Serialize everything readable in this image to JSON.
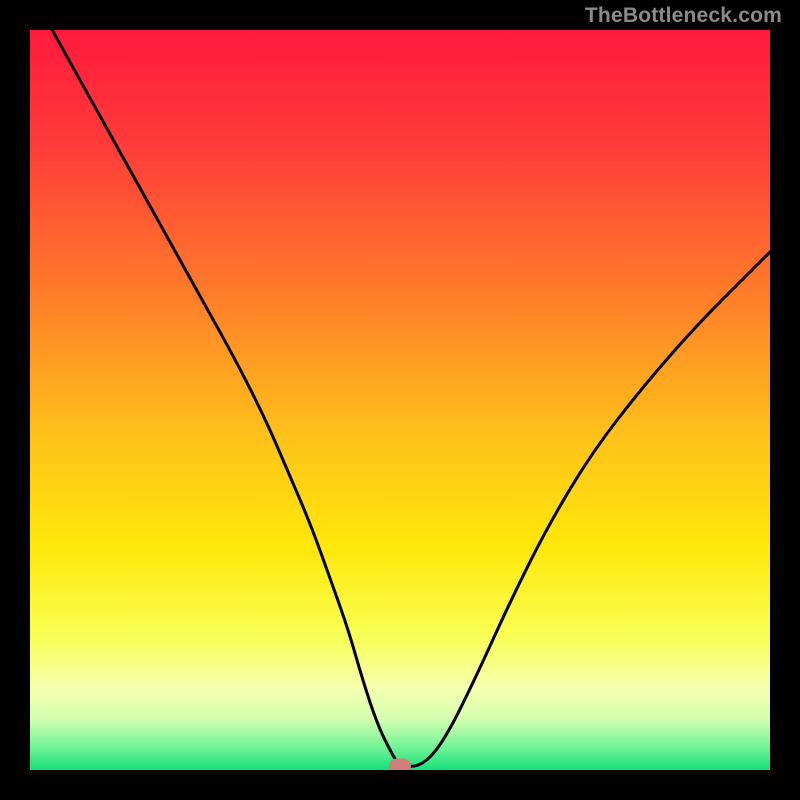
{
  "attribution": "TheBottleneck.com",
  "colors": {
    "background_frame": "#000000",
    "gradient_stops": [
      {
        "offset": 0.0,
        "color": "#ff1a3c"
      },
      {
        "offset": 0.15,
        "color": "#ff3a3a"
      },
      {
        "offset": 0.35,
        "color": "#ff7a2a"
      },
      {
        "offset": 0.55,
        "color": "#ffc21a"
      },
      {
        "offset": 0.7,
        "color": "#ffe80a"
      },
      {
        "offset": 0.82,
        "color": "#f8ff55"
      },
      {
        "offset": 0.89,
        "color": "#f6ffb0"
      },
      {
        "offset": 0.93,
        "color": "#d6ffb0"
      },
      {
        "offset": 0.965,
        "color": "#7df59a"
      },
      {
        "offset": 1.0,
        "color": "#16e07a"
      }
    ],
    "curve_stroke": "#000000",
    "marker_fill": "#cf7f77"
  },
  "chart_data": {
    "type": "line",
    "title": "",
    "xlabel": "",
    "ylabel": "",
    "xlim": [
      0,
      100
    ],
    "ylim": [
      0,
      100
    ],
    "series": [
      {
        "name": "bottleneck-curve",
        "x": [
          3,
          8,
          13,
          18,
          23,
          28,
          32,
          35,
          38,
          40.5,
          43,
          45,
          47,
          49,
          50,
          53,
          56,
          60,
          65,
          70,
          76,
          83,
          90,
          97,
          100
        ],
        "y": [
          100,
          91,
          82,
          73,
          64,
          55,
          47,
          40,
          33,
          26,
          19,
          12,
          6,
          2,
          0.5,
          0.5,
          4,
          12,
          23,
          33,
          43,
          52,
          60,
          67,
          70
        ]
      }
    ],
    "marker": {
      "x": 50,
      "y": 0.5
    },
    "flat_segment": {
      "x_start": 47,
      "x_end": 53,
      "y": 0.5
    }
  }
}
